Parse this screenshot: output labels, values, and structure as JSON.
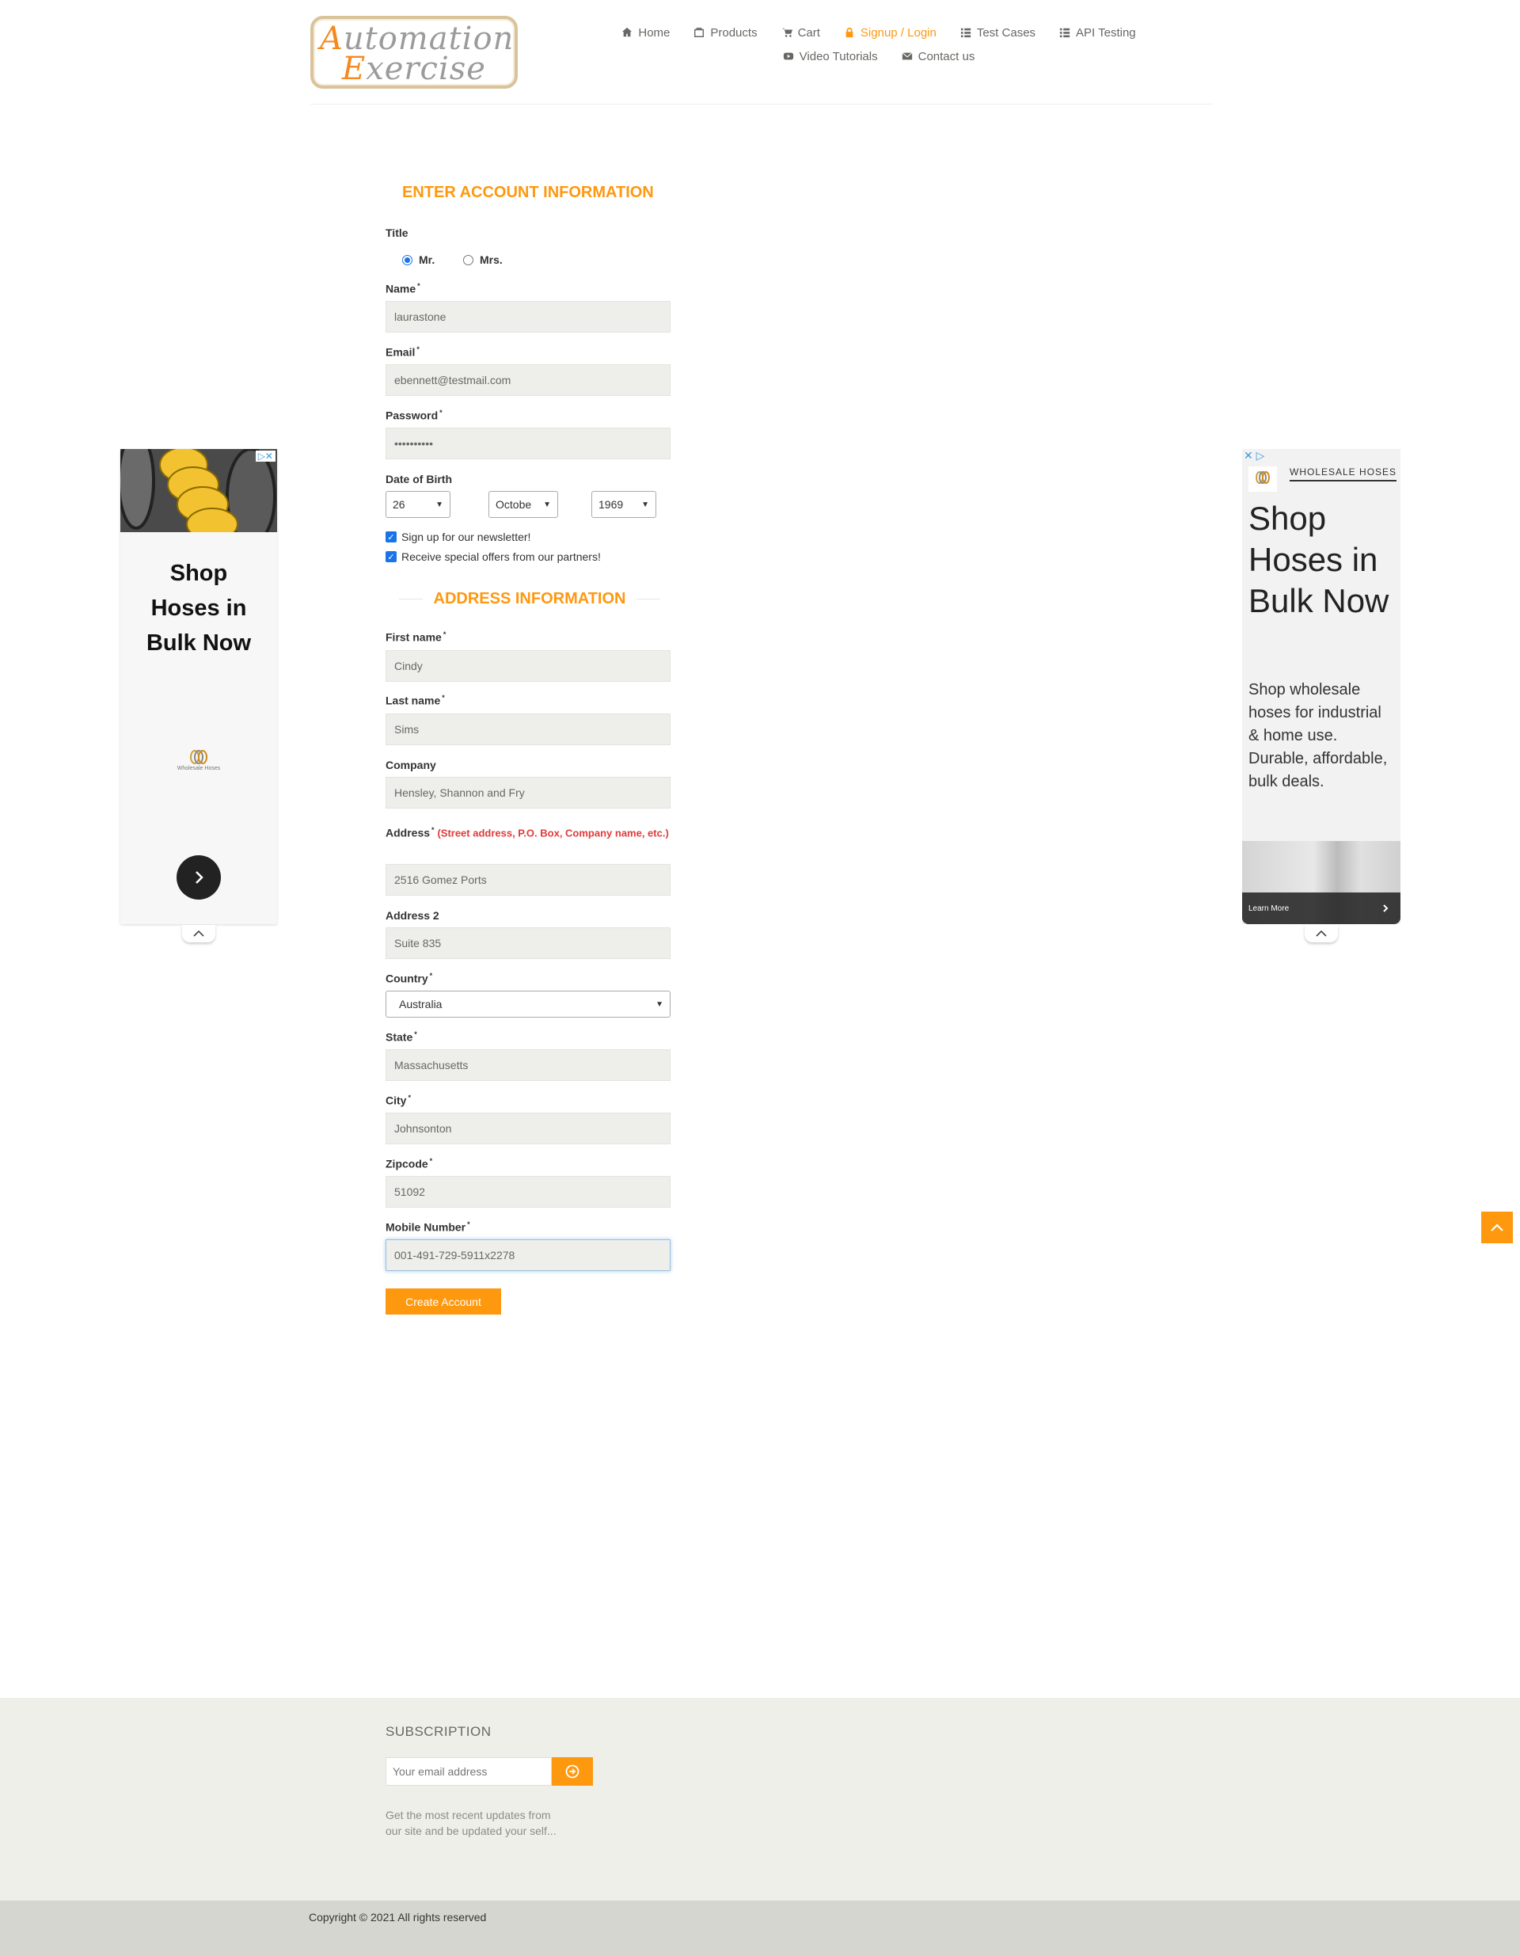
{
  "logo": {
    "line1_cap": "A",
    "line1_rest": "utomation",
    "line2_cap": "E",
    "line2_rest": "xercise"
  },
  "nav": {
    "row1": [
      {
        "label": "Home",
        "icon": "home-icon",
        "active": false
      },
      {
        "label": "Products",
        "icon": "products-icon",
        "active": false
      },
      {
        "label": "Cart",
        "icon": "cart-icon",
        "active": false
      },
      {
        "label": "Signup / Login",
        "icon": "lock-icon",
        "active": true
      },
      {
        "label": "Test Cases",
        "icon": "list-icon",
        "active": false
      },
      {
        "label": "API Testing",
        "icon": "list-icon",
        "active": false
      }
    ],
    "row2": [
      {
        "label": "Video Tutorials",
        "icon": "youtube-icon"
      },
      {
        "label": "Contact us",
        "icon": "envelope-icon"
      }
    ]
  },
  "form": {
    "account_title": "ENTER ACCOUNT INFORMATION",
    "title_label": "Title",
    "title_options": [
      "Mr.",
      "Mrs."
    ],
    "title_selected": "Mr.",
    "name_label": "Name",
    "name_value": "laurastone",
    "email_label": "Email",
    "email_value": "ebennett@testmail.com",
    "password_label": "Password",
    "password_value": "••••••••••",
    "dob_label": "Date of Birth",
    "dob_day": "26",
    "dob_month": "Octobe",
    "dob_year": "1969",
    "newsletter_label": "Sign up for our newsletter!",
    "offers_label": "Receive special offers from our partners!",
    "address_title": "ADDRESS INFORMATION",
    "first_name_label": "First name",
    "first_name_value": "Cindy",
    "last_name_label": "Last name",
    "last_name_value": "Sims",
    "company_label": "Company",
    "company_value": "Hensley, Shannon and Fry",
    "address_label": "Address",
    "address_hint": "(Street address, P.O. Box, Company name, etc.)",
    "address_value": "2516 Gomez Ports",
    "address2_label": "Address 2",
    "address2_value": "Suite 835",
    "country_label": "Country",
    "country_value": "Australia",
    "state_label": "State",
    "state_value": "Massachusetts",
    "city_label": "City",
    "city_value": "Johnsonton",
    "zipcode_label": "Zipcode",
    "zipcode_value": "51092",
    "mobile_label": "Mobile Number",
    "mobile_value": "001-491-729-5911x2278",
    "required_mark": "*",
    "create_button": "Create Account"
  },
  "ad_left": {
    "headline_1": "Shop",
    "headline_2": "Hoses in",
    "headline_3": "Bulk Now",
    "brand": "Wholesale Hoses"
  },
  "ad_right": {
    "brand": "WHOLESALE HOSES",
    "headline": "Shop Hoses in Bulk Now",
    "description": "Shop wholesale hoses for industrial & home use. Durable, affordable, bulk deals.",
    "cta": "Learn More"
  },
  "footer": {
    "subscription_title": "SUBSCRIPTION",
    "email_placeholder": "Your email address",
    "description": "Get the most recent updates from our site and be updated your self...",
    "copyright": "Copyright © 2021 All rights reserved"
  },
  "colors": {
    "accent": "#fe980f",
    "footer_bg": "#efefea",
    "copyright_bg": "#d6d6d0",
    "input_bg": "#eeeeea"
  }
}
